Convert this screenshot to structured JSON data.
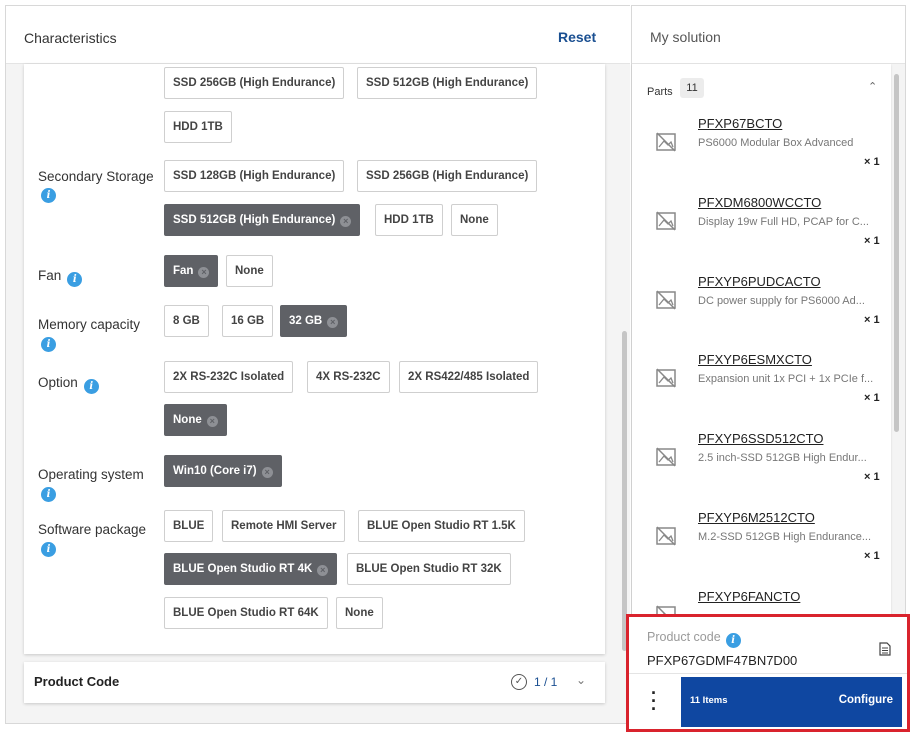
{
  "characteristics": {
    "title": "Characteristics",
    "reset_label": "Reset",
    "storage_top_options": [
      {
        "label": "SSD 256GB (High Endurance)",
        "selected": false
      },
      {
        "label": "SSD 512GB (High Endurance)",
        "selected": false
      },
      {
        "label": "HDD 1TB",
        "selected": false
      }
    ],
    "secondary_storage": {
      "label": "Secondary Storage",
      "options": [
        {
          "label": "SSD 128GB (High Endurance)",
          "selected": false
        },
        {
          "label": "SSD 256GB (High Endurance)",
          "selected": false
        },
        {
          "label": "SSD 512GB (High Endurance)",
          "selected": true
        },
        {
          "label": "HDD 1TB",
          "selected": false
        },
        {
          "label": "None",
          "selected": false
        }
      ]
    },
    "fan": {
      "label": "Fan",
      "options": [
        {
          "label": "Fan",
          "selected": true
        },
        {
          "label": "None",
          "selected": false
        }
      ]
    },
    "memory_capacity": {
      "label": "Memory capacity",
      "options": [
        {
          "label": "8 GB",
          "selected": false
        },
        {
          "label": "16 GB",
          "selected": false
        },
        {
          "label": "32 GB",
          "selected": true
        }
      ]
    },
    "option": {
      "label": "Option",
      "options": [
        {
          "label": "2X RS-232C Isolated",
          "selected": false
        },
        {
          "label": "4X RS-232C",
          "selected": false
        },
        {
          "label": "2X RS422/485 Isolated",
          "selected": false
        },
        {
          "label": "None",
          "selected": true
        }
      ]
    },
    "operating_system": {
      "label": "Operating system",
      "options": [
        {
          "label": "Win10 (Core i7)",
          "selected": true
        }
      ]
    },
    "software_package": {
      "label": "Software package",
      "options": [
        {
          "label": "BLUE",
          "selected": false
        },
        {
          "label": "Remote HMI Server",
          "selected": false
        },
        {
          "label": "BLUE Open Studio RT 1.5K",
          "selected": false
        },
        {
          "label": "BLUE Open Studio RT 4K",
          "selected": true
        },
        {
          "label": "BLUE Open Studio RT 32K",
          "selected": false
        },
        {
          "label": "BLUE Open Studio RT 64K",
          "selected": false
        },
        {
          "label": "None",
          "selected": false
        }
      ]
    },
    "product_code_section": {
      "title": "Product Code",
      "status": "1 / 1"
    }
  },
  "solution": {
    "title": "My solution",
    "parts_label": "Parts",
    "parts_count": "11",
    "parts": [
      {
        "code": "PFXP67BCTO",
        "desc": "PS6000 Modular Box Advanced",
        "qty": "× 1"
      },
      {
        "code": "PFXDM6800WCCTO",
        "desc": "Display 19w Full HD, PCAP for C...",
        "qty": "× 1"
      },
      {
        "code": "PFXYP6PUDCACTO",
        "desc": "DC power supply for PS6000 Ad...",
        "qty": "× 1"
      },
      {
        "code": "PFXYP6ESMXCTO",
        "desc": "Expansion unit 1x PCI + 1x PCIe f...",
        "qty": "× 1"
      },
      {
        "code": "PFXYP6SSD512CTO",
        "desc": "2.5 inch-SSD 512GB High Endur...",
        "qty": "× 1"
      },
      {
        "code": "PFXYP6M2512CTO",
        "desc": "M.2-SSD 512GB High Endurance...",
        "qty": "× 1"
      },
      {
        "code": "PFXYP6FANCTO",
        "desc": "",
        "qty": ""
      }
    ],
    "product_code_label": "Product code",
    "product_code_value": "PFXP67GDMF47BN7D00",
    "items_label": "11 Items",
    "configure_label": "Configure"
  },
  "colors": {
    "accent": "#0f47a1",
    "selected_chip": "#5f6166",
    "highlight_border": "#d9232d",
    "info_icon": "#3a9ee2"
  }
}
